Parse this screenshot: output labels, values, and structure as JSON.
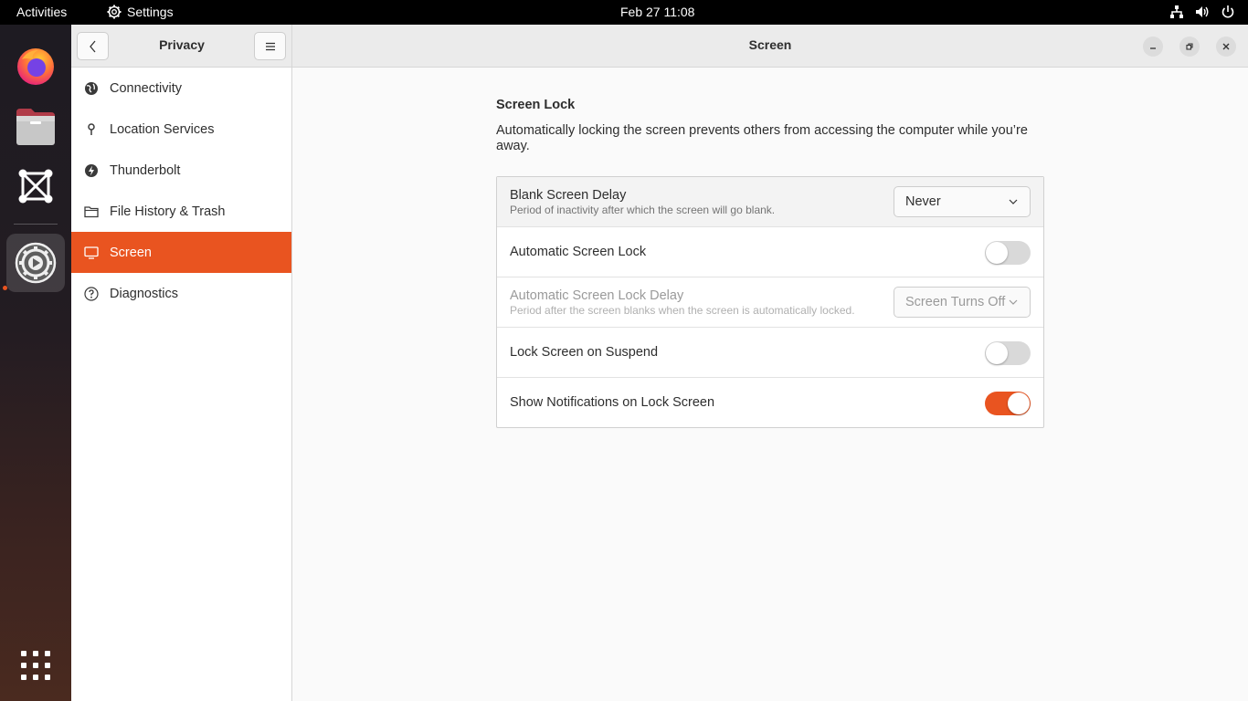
{
  "topbar": {
    "activities": "Activities",
    "app_name": "Settings",
    "clock": "Feb 27  11:08"
  },
  "dock": {
    "items": [
      {
        "name": "firefox"
      },
      {
        "name": "files"
      },
      {
        "name": "app"
      },
      {
        "name": "settings",
        "active": true
      }
    ]
  },
  "sidebar": {
    "title": "Privacy",
    "items": [
      {
        "label": "Connectivity",
        "icon": "globe-icon"
      },
      {
        "label": "Location Services",
        "icon": "location-icon"
      },
      {
        "label": "Thunderbolt",
        "icon": "thunderbolt-icon"
      },
      {
        "label": "File History & Trash",
        "icon": "folder-icon"
      },
      {
        "label": "Screen",
        "icon": "monitor-icon",
        "selected": true
      },
      {
        "label": "Diagnostics",
        "icon": "help-icon"
      }
    ]
  },
  "main": {
    "title": "Screen",
    "section_title": "Screen Lock",
    "section_desc": "Automatically locking the screen prevents others from accessing the computer while you’re away.",
    "rows": [
      {
        "title": "Blank Screen Delay",
        "subtitle": "Period of inactivity after which the screen will go blank.",
        "dropdown": "Never"
      },
      {
        "title": "Automatic Screen Lock",
        "toggle": false
      },
      {
        "title": "Automatic Screen Lock Delay",
        "subtitle": "Period after the screen blanks when the screen is automatically locked.",
        "dropdown": "Screen Turns Off",
        "disabled": true
      },
      {
        "title": "Lock Screen on Suspend",
        "toggle": false
      },
      {
        "title": "Show Notifications on Lock Screen",
        "toggle": true
      }
    ]
  },
  "colors": {
    "accent": "#e95420"
  }
}
